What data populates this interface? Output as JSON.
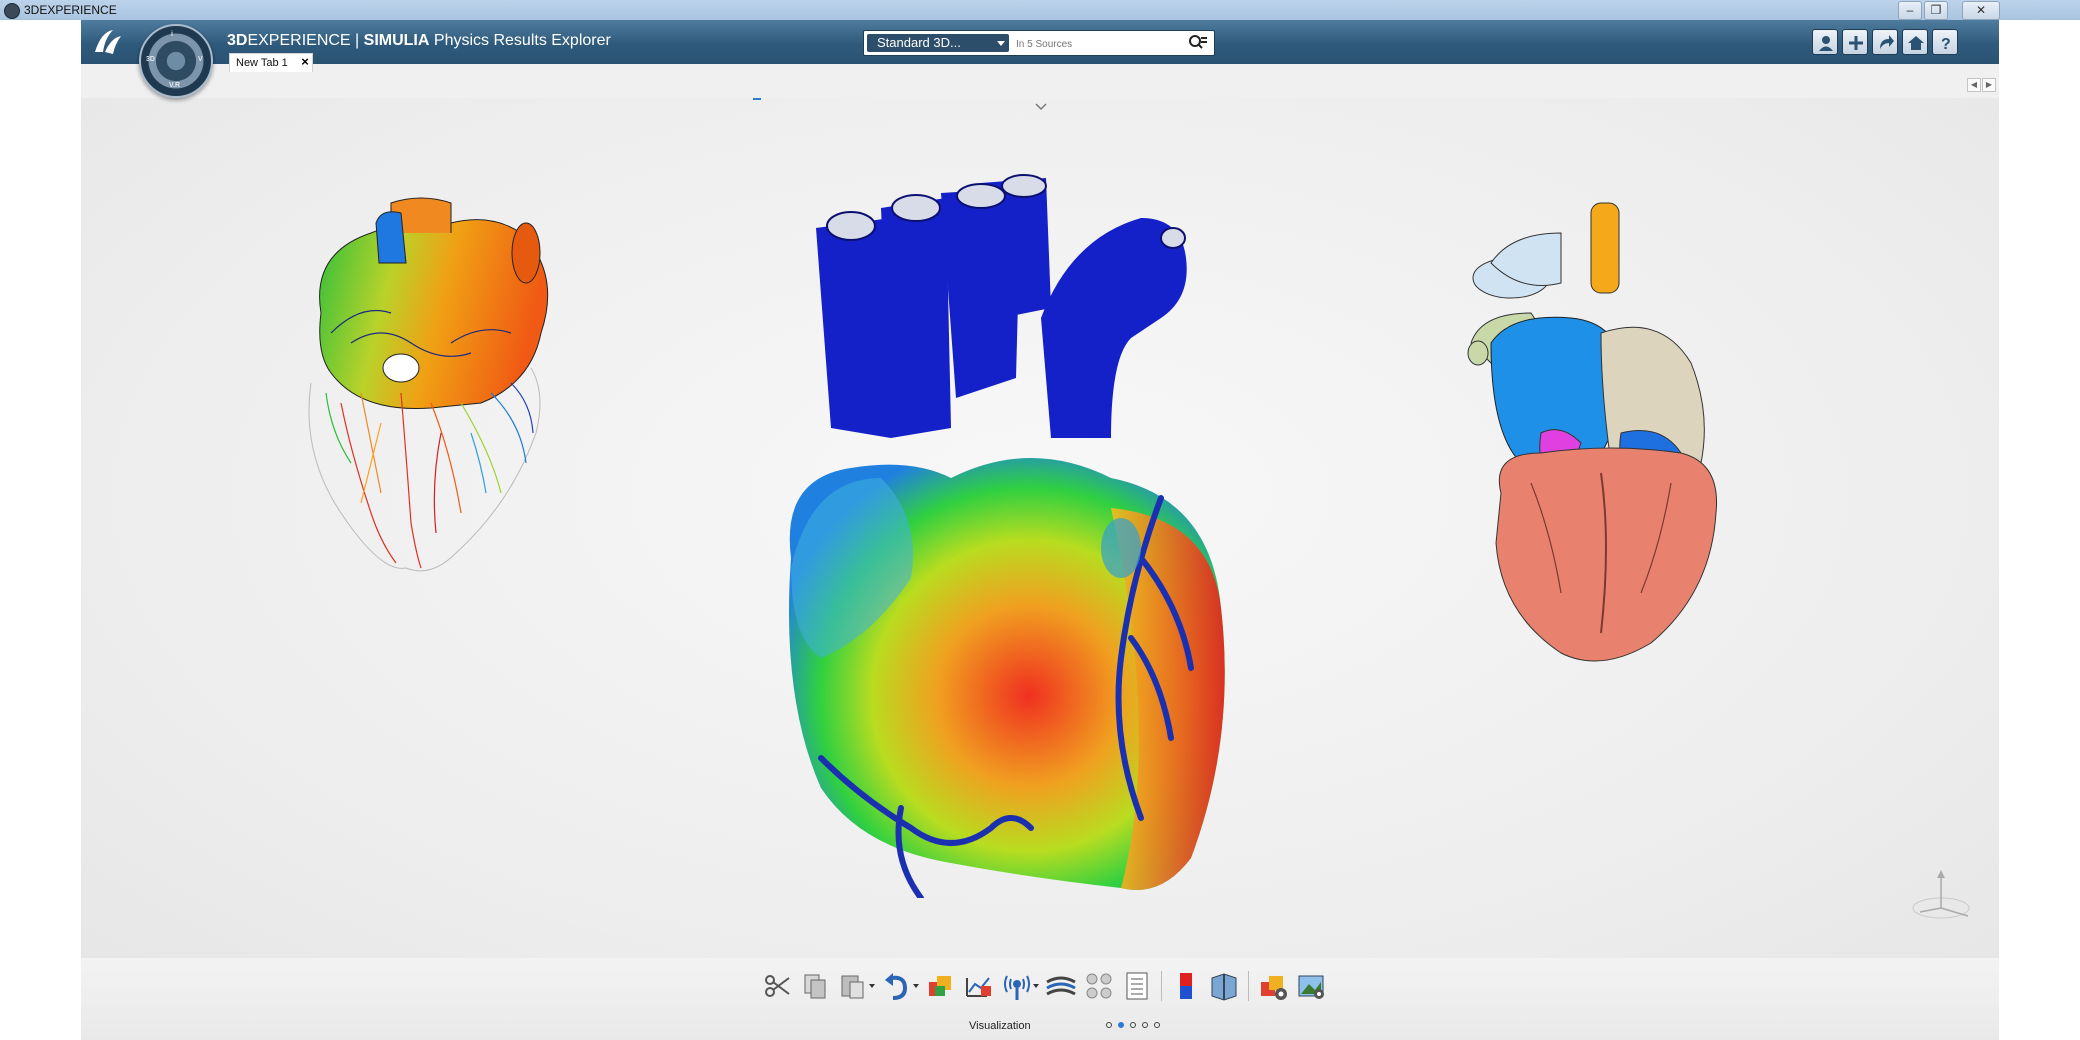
{
  "window": {
    "title": "3DEXPERIENCE",
    "controls": [
      "minimize",
      "restore",
      "close"
    ]
  },
  "header": {
    "brand_prefix": "3D",
    "brand_main": "EXPERIENCE",
    "separator": "|",
    "brand_simulia": "SIMULIA",
    "app_name": "Physics Results Explorer",
    "compass_quadrants": [
      "3D",
      "V",
      "V.R",
      "i"
    ]
  },
  "search": {
    "scope": "Standard 3D...",
    "placeholder": "In 5 Sources"
  },
  "header_icons": [
    "user-profile-icon",
    "add-icon",
    "share-icon",
    "home-icon",
    "help-icon"
  ],
  "tabs": [
    {
      "label": "New Tab 1",
      "active": true
    }
  ],
  "viewport": {
    "models": [
      {
        "name": "heart-model-vascular",
        "colormap": "rainbow"
      },
      {
        "name": "heart-model-contour",
        "colormap": "blue-green-red"
      },
      {
        "name": "heart-model-sectioned",
        "colormap": "segmented"
      }
    ]
  },
  "action_bar": {
    "tools": [
      "cut-icon",
      "copy-icon",
      "paste-icon",
      "undo-icon",
      "render-icon",
      "sensor-icon",
      "probe-icon",
      "streamline-icon",
      "particles-icon",
      "report-icon",
      "color-legend-icon",
      "section-icon",
      "result-settings-icon",
      "capture-icon"
    ],
    "section": "Visualization",
    "pages": 5,
    "active_page": 2
  },
  "colors": {
    "header_blue": "#2f5a7c",
    "viewport_bg": "#efefef",
    "active_dot": "#2b7bd4"
  }
}
